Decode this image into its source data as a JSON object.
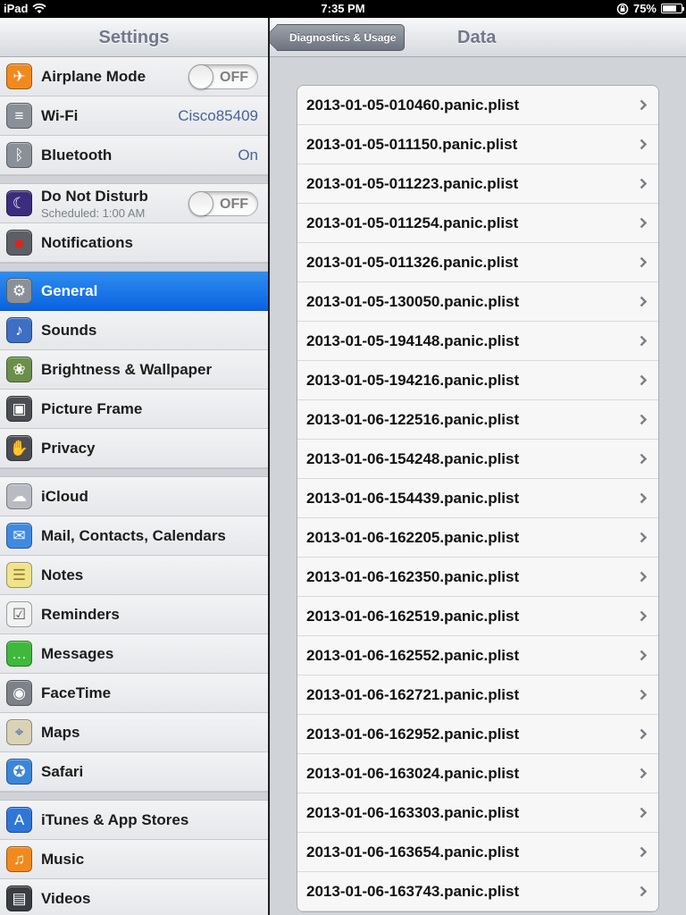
{
  "status_bar": {
    "device": "iPad",
    "time": "7:35 PM",
    "battery": "75%",
    "battery_level": 0.75
  },
  "master": {
    "title": "Settings",
    "items": [
      {
        "label": "Airplane Mode",
        "icon": "airplane-icon",
        "toggle": "OFF",
        "color": "#f08a1e"
      },
      {
        "label": "Wi-Fi",
        "icon": "wifi-icon",
        "value": "Cisco85409",
        "color": "#8a9097"
      },
      {
        "label": "Bluetooth",
        "icon": "bluetooth-icon",
        "value": "On",
        "color": "#8a9097"
      },
      {
        "label": "Do Not Disturb",
        "sublabel": "Scheduled: 1:00 AM",
        "icon": "moon-icon",
        "toggle": "OFF",
        "color": "#3c2c7e"
      },
      {
        "label": "Notifications",
        "icon": "notifications-icon",
        "color": "#5b5f66"
      },
      {
        "label": "General",
        "icon": "gear-icon",
        "color": "#8a9097",
        "selected": true
      },
      {
        "label": "Sounds",
        "icon": "speaker-icon",
        "color": "#3e6fc4"
      },
      {
        "label": "Brightness & Wallpaper",
        "icon": "flower-icon",
        "color": "#6b8f4a"
      },
      {
        "label": "Picture Frame",
        "icon": "picture-frame-icon",
        "color": "#4a4d52"
      },
      {
        "label": "Privacy",
        "icon": "hand-icon",
        "color": "#4a4d52"
      },
      {
        "label": "iCloud",
        "icon": "cloud-icon",
        "color": "#b8bcc2"
      },
      {
        "label": "Mail, Contacts, Calendars",
        "icon": "mail-icon",
        "color": "#3f8ae0"
      },
      {
        "label": "Notes",
        "icon": "notes-icon",
        "color": "#f1e38a"
      },
      {
        "label": "Reminders",
        "icon": "reminders-icon",
        "color": "#f2f2f2"
      },
      {
        "label": "Messages",
        "icon": "speech-bubble-icon",
        "color": "#3fb83c"
      },
      {
        "label": "FaceTime",
        "icon": "camera-icon",
        "color": "#7d8188"
      },
      {
        "label": "Maps",
        "icon": "map-icon",
        "color": "#d9d2b4"
      },
      {
        "label": "Safari",
        "icon": "compass-icon",
        "color": "#3b86d8"
      },
      {
        "label": "iTunes & App Stores",
        "icon": "app-store-icon",
        "color": "#2f76d6"
      },
      {
        "label": "Music",
        "icon": "music-note-icon",
        "color": "#f08a1e"
      },
      {
        "label": "Videos",
        "icon": "clapperboard-icon",
        "color": "#3a3d42"
      }
    ]
  },
  "detail": {
    "back_label": "Diagnostics & Usage",
    "title": "Data",
    "files": [
      "2013-01-05-010460.panic.plist",
      "2013-01-05-011150.panic.plist",
      "2013-01-05-011223.panic.plist",
      "2013-01-05-011254.panic.plist",
      "2013-01-05-011326.panic.plist",
      "2013-01-05-130050.panic.plist",
      "2013-01-05-194148.panic.plist",
      "2013-01-05-194216.panic.plist",
      "2013-01-06-122516.panic.plist",
      "2013-01-06-154248.panic.plist",
      "2013-01-06-154439.panic.plist",
      "2013-01-06-162205.panic.plist",
      "2013-01-06-162350.panic.plist",
      "2013-01-06-162519.panic.plist",
      "2013-01-06-162552.panic.plist",
      "2013-01-06-162721.panic.plist",
      "2013-01-06-162952.panic.plist",
      "2013-01-06-163024.panic.plist",
      "2013-01-06-163303.panic.plist",
      "2013-01-06-163654.panic.plist",
      "2013-01-06-163743.panic.plist"
    ]
  }
}
